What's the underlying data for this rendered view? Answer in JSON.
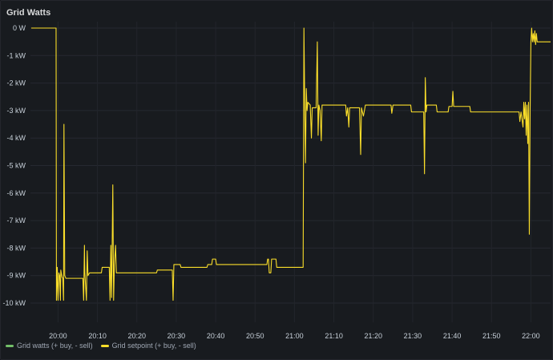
{
  "panel": {
    "title": "Grid Watts"
  },
  "chart_data": {
    "type": "line",
    "title": "Grid Watts",
    "ylim": [
      -10000,
      0
    ],
    "y_ticks": [
      {
        "value": 0,
        "label": "0 W"
      },
      {
        "value": -1000,
        "label": "-1 kW"
      },
      {
        "value": -2000,
        "label": "-2 kW"
      },
      {
        "value": -3000,
        "label": "-3 kW"
      },
      {
        "value": -4000,
        "label": "-4 kW"
      },
      {
        "value": -5000,
        "label": "-5 kW"
      },
      {
        "value": -6000,
        "label": "-6 kW"
      },
      {
        "value": -7000,
        "label": "-7 kW"
      },
      {
        "value": -8000,
        "label": "-8 kW"
      },
      {
        "value": -9000,
        "label": "-9 kW"
      },
      {
        "value": -10000,
        "label": "-10 kW"
      }
    ],
    "xlim_minutes": [
      1193,
      1325
    ],
    "x_ticks": [
      {
        "value": 1200,
        "label": "20:00"
      },
      {
        "value": 1210,
        "label": "20:10"
      },
      {
        "value": 1220,
        "label": "20:20"
      },
      {
        "value": 1230,
        "label": "20:30"
      },
      {
        "value": 1240,
        "label": "20:40"
      },
      {
        "value": 1250,
        "label": "20:50"
      },
      {
        "value": 1260,
        "label": "21:00"
      },
      {
        "value": 1270,
        "label": "21:10"
      },
      {
        "value": 1280,
        "label": "21:20"
      },
      {
        "value": 1290,
        "label": "21:30"
      },
      {
        "value": 1300,
        "label": "21:40"
      },
      {
        "value": 1310,
        "label": "21:50"
      },
      {
        "value": 1320,
        "label": "22:00"
      }
    ],
    "grid": true,
    "legend_position": "bottom-left",
    "series": [
      {
        "name": "Grid watts (+ buy, - sell)",
        "color": "#73bf69",
        "points": []
      },
      {
        "name": "Grid setpoint (+ buy, - sell)",
        "color": "#fade2a",
        "points": [
          [
            1193.2,
            0
          ],
          [
            1199.5,
            0
          ],
          [
            1199.6,
            -9900
          ],
          [
            1199.8,
            -8700
          ],
          [
            1200.0,
            -9900
          ],
          [
            1200.2,
            -8900
          ],
          [
            1200.4,
            -9000
          ],
          [
            1200.6,
            -9900
          ],
          [
            1200.7,
            -8800
          ],
          [
            1201.0,
            -9050
          ],
          [
            1201.2,
            -9100
          ],
          [
            1201.4,
            -9900
          ],
          [
            1201.5,
            -3500
          ],
          [
            1201.7,
            -9000
          ],
          [
            1202.0,
            -9100
          ],
          [
            1206.3,
            -9100
          ],
          [
            1206.5,
            -9900
          ],
          [
            1206.7,
            -7900
          ],
          [
            1206.8,
            -8900
          ],
          [
            1207.2,
            -9900
          ],
          [
            1207.4,
            -8100
          ],
          [
            1207.6,
            -9000
          ],
          [
            1208.0,
            -8900
          ],
          [
            1211.0,
            -8900
          ],
          [
            1211.2,
            -8700
          ],
          [
            1213.0,
            -8700
          ],
          [
            1213.2,
            -9900
          ],
          [
            1213.4,
            -7900
          ],
          [
            1213.6,
            -9800
          ],
          [
            1213.9,
            -5700
          ],
          [
            1214.1,
            -9900
          ],
          [
            1214.3,
            -8600
          ],
          [
            1214.6,
            -7900
          ],
          [
            1214.8,
            -8900
          ],
          [
            1225.0,
            -8900
          ],
          [
            1225.2,
            -8800
          ],
          [
            1229.0,
            -8800
          ],
          [
            1229.2,
            -9900
          ],
          [
            1229.4,
            -8600
          ],
          [
            1231.0,
            -8600
          ],
          [
            1231.2,
            -8700
          ],
          [
            1237.8,
            -8700
          ],
          [
            1238.0,
            -8600
          ],
          [
            1239.0,
            -8600
          ],
          [
            1239.2,
            -8400
          ],
          [
            1240.0,
            -8400
          ],
          [
            1240.2,
            -8600
          ],
          [
            1253.0,
            -8600
          ],
          [
            1253.2,
            -8400
          ],
          [
            1253.4,
            -8400
          ],
          [
            1253.6,
            -8900
          ],
          [
            1254.0,
            -8900
          ],
          [
            1254.2,
            -8400
          ],
          [
            1255.3,
            -8400
          ],
          [
            1255.5,
            -8700
          ],
          [
            1262.2,
            -8700
          ],
          [
            1262.4,
            0
          ],
          [
            1262.6,
            -2700
          ],
          [
            1262.8,
            -4900
          ],
          [
            1263.0,
            -2200
          ],
          [
            1263.2,
            -3000
          ],
          [
            1263.4,
            -2700
          ],
          [
            1264.0,
            -2800
          ],
          [
            1264.3,
            -4000
          ],
          [
            1264.5,
            -2900
          ],
          [
            1265.5,
            -2900
          ],
          [
            1265.8,
            -500
          ],
          [
            1266.0,
            -3900
          ],
          [
            1266.2,
            -2800
          ],
          [
            1266.5,
            -3000
          ],
          [
            1266.8,
            -4100
          ],
          [
            1267.0,
            -2800
          ],
          [
            1273.0,
            -2800
          ],
          [
            1273.2,
            -3200
          ],
          [
            1273.5,
            -2900
          ],
          [
            1273.8,
            -3600
          ],
          [
            1274.0,
            -2900
          ],
          [
            1276.5,
            -2900
          ],
          [
            1276.8,
            -4600
          ],
          [
            1277.0,
            -2900
          ],
          [
            1277.5,
            -3200
          ],
          [
            1278.0,
            -2800
          ],
          [
            1284.5,
            -2800
          ],
          [
            1284.7,
            -3100
          ],
          [
            1285.0,
            -2800
          ],
          [
            1289.5,
            -2800
          ],
          [
            1289.7,
            -3050
          ],
          [
            1292.8,
            -3050
          ],
          [
            1293.0,
            -5300
          ],
          [
            1293.2,
            -1800
          ],
          [
            1293.4,
            -3050
          ],
          [
            1293.6,
            -2800
          ],
          [
            1296.0,
            -2800
          ],
          [
            1296.2,
            -3050
          ],
          [
            1299.0,
            -3050
          ],
          [
            1299.2,
            -2850
          ],
          [
            1300.0,
            -2850
          ],
          [
            1300.2,
            -2300
          ],
          [
            1300.4,
            -2850
          ],
          [
            1304.5,
            -2850
          ],
          [
            1304.7,
            -3050
          ],
          [
            1317.0,
            -3050
          ],
          [
            1317.2,
            -3400
          ],
          [
            1317.5,
            -3050
          ],
          [
            1318.0,
            -3600
          ],
          [
            1318.2,
            -2700
          ],
          [
            1318.4,
            -3300
          ],
          [
            1318.6,
            -2700
          ],
          [
            1318.8,
            -3900
          ],
          [
            1319.0,
            -2800
          ],
          [
            1319.2,
            -4200
          ],
          [
            1319.4,
            -2700
          ],
          [
            1319.6,
            -7500
          ],
          [
            1319.8,
            -3000
          ],
          [
            1320.0,
            -500
          ],
          [
            1320.2,
            0
          ],
          [
            1320.4,
            -500
          ],
          [
            1320.6,
            -200
          ],
          [
            1320.8,
            -500
          ],
          [
            1321.0,
            -100
          ],
          [
            1321.2,
            -600
          ],
          [
            1321.4,
            -200
          ],
          [
            1321.6,
            -500
          ],
          [
            1325.0,
            -500
          ]
        ]
      }
    ]
  }
}
